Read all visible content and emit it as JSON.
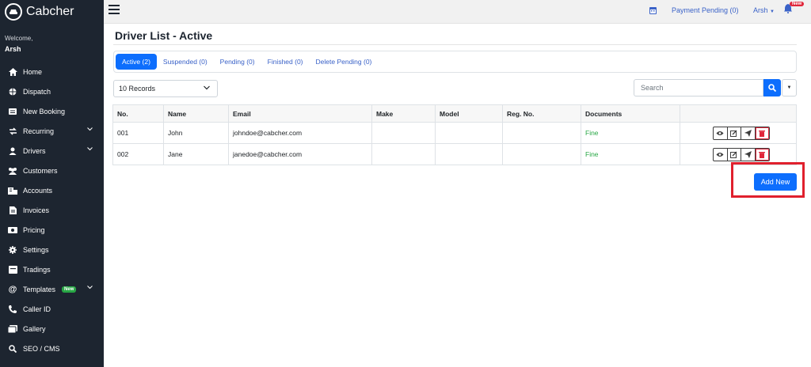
{
  "app": {
    "brand": "Cabcher"
  },
  "sidebar": {
    "welcome": "Welcome,",
    "user": "Arsh",
    "items": [
      {
        "label": "Home",
        "icon": "home-icon"
      },
      {
        "label": "Dispatch",
        "icon": "globe-icon"
      },
      {
        "label": "New Booking",
        "icon": "booking-icon"
      },
      {
        "label": "Recurring",
        "icon": "recurring-icon"
      },
      {
        "label": "Drivers",
        "icon": "driver-icon"
      },
      {
        "label": "Customers",
        "icon": "customers-icon"
      },
      {
        "label": "Accounts",
        "icon": "accounts-icon"
      },
      {
        "label": "Invoices",
        "icon": "invoice-icon"
      },
      {
        "label": "Pricing",
        "icon": "pricing-icon"
      },
      {
        "label": "Settings",
        "icon": "gear-icon"
      },
      {
        "label": "Tradings",
        "icon": "tradings-icon"
      },
      {
        "label": "Templates",
        "icon": "at-icon",
        "badge": "New"
      },
      {
        "label": "Caller ID",
        "icon": "phone-icon"
      },
      {
        "label": "Gallery",
        "icon": "gallery-icon"
      },
      {
        "label": "SEO / CMS",
        "icon": "search-icon"
      }
    ]
  },
  "topbar": {
    "payment_pending": "Payment Pending (0)",
    "user": "Arsh",
    "bell_badge": "New"
  },
  "page": {
    "title": "Driver List - Active"
  },
  "tabs": [
    {
      "label": "Active (2)",
      "active": true
    },
    {
      "label": "Suspended (0)"
    },
    {
      "label": "Pending (0)"
    },
    {
      "label": "Finished (0)"
    },
    {
      "label": "Delete Pending (0)"
    }
  ],
  "records_select": "10 Records",
  "search": {
    "placeholder": "Search"
  },
  "table": {
    "headers": [
      "No.",
      "Name",
      "Email",
      "Make",
      "Model",
      "Reg. No.",
      "Documents",
      ""
    ],
    "rows": [
      {
        "no": "001",
        "name": "John",
        "email": "johndoe@cabcher.com",
        "make": "",
        "model": "",
        "reg": "",
        "documents": "Fine"
      },
      {
        "no": "002",
        "name": "Jane",
        "email": "janedoe@cabcher.com",
        "make": "",
        "model": "",
        "reg": "",
        "documents": "Fine"
      }
    ]
  },
  "add_new": "Add New",
  "colors": {
    "sidebar_bg": "#1d2530",
    "primary": "#0d6efd",
    "danger": "#e0263a",
    "success": "#28a745"
  }
}
